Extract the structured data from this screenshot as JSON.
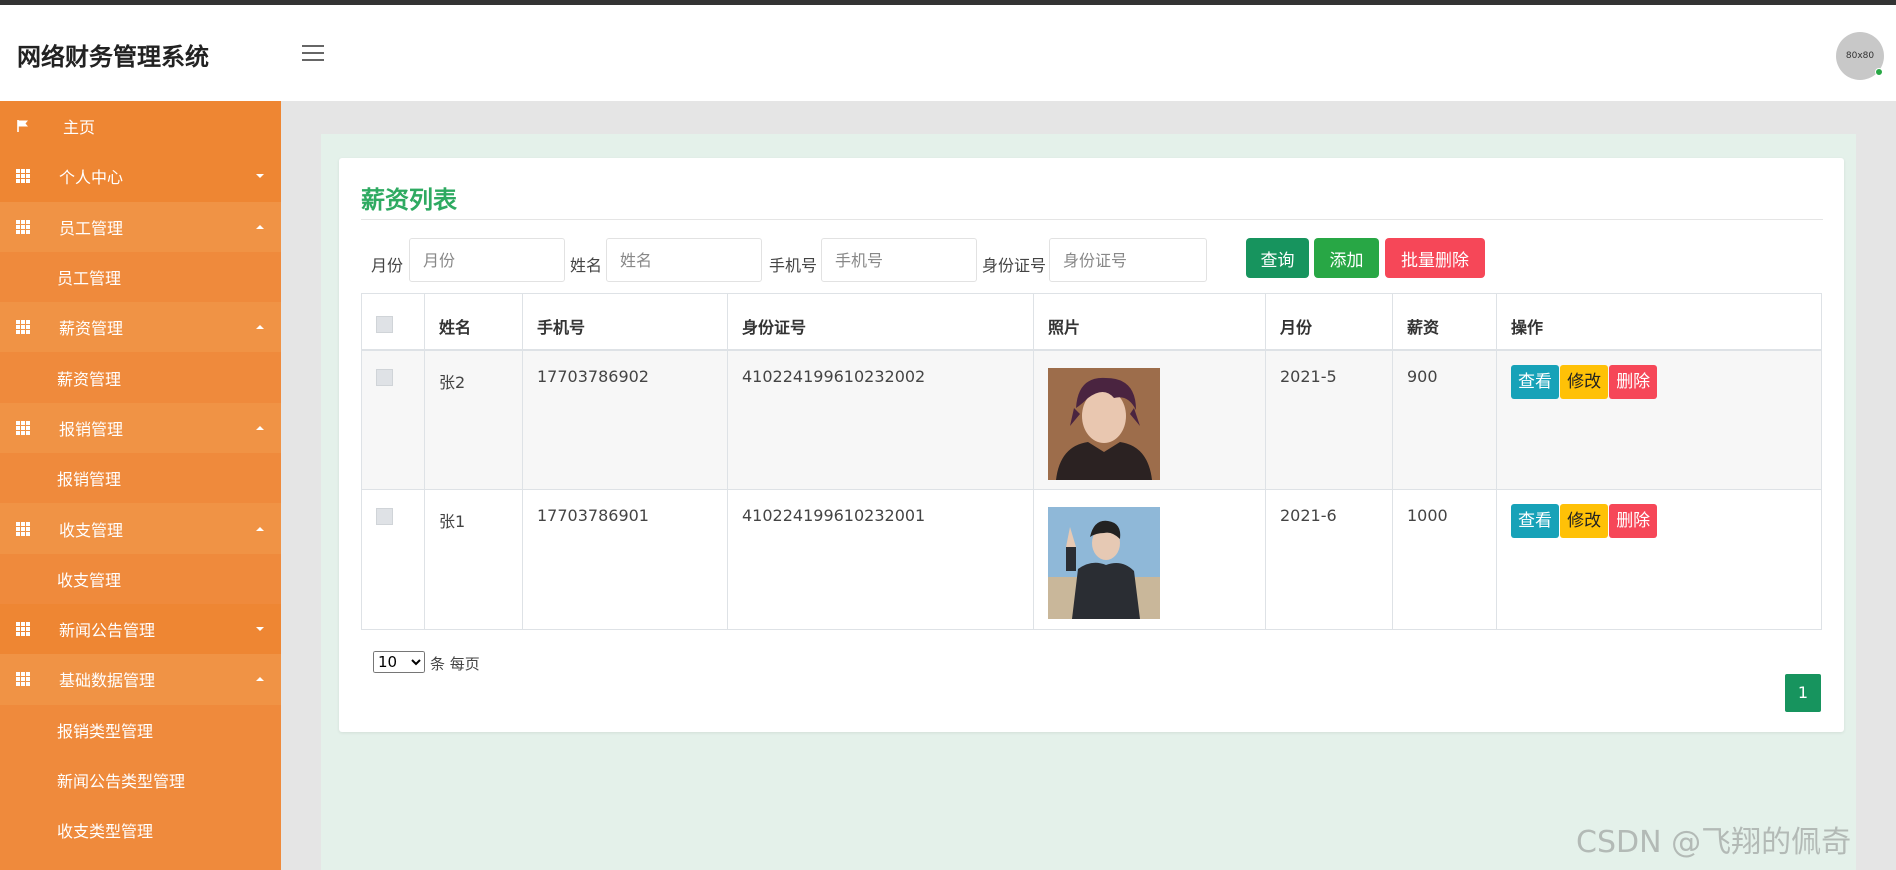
{
  "app": {
    "title": "网络财务管理系统",
    "avatar_text": "80x80"
  },
  "sidebar": {
    "items": [
      {
        "label": "主页",
        "type": "home"
      },
      {
        "label": "个人中心",
        "type": "parent",
        "expanded": false
      },
      {
        "label": "员工管理",
        "type": "parent",
        "expanded": true
      },
      {
        "label": "员工管理",
        "type": "child"
      },
      {
        "label": "薪资管理",
        "type": "parent",
        "expanded": true
      },
      {
        "label": "薪资管理",
        "type": "child"
      },
      {
        "label": "报销管理",
        "type": "parent",
        "expanded": true
      },
      {
        "label": "报销管理",
        "type": "child"
      },
      {
        "label": "收支管理",
        "type": "parent",
        "expanded": true
      },
      {
        "label": "收支管理",
        "type": "child"
      },
      {
        "label": "新闻公告管理",
        "type": "parent",
        "expanded": false
      },
      {
        "label": "基础数据管理",
        "type": "parent",
        "expanded": true
      },
      {
        "label": "报销类型管理",
        "type": "child"
      },
      {
        "label": "新闻公告类型管理",
        "type": "child"
      },
      {
        "label": "收支类型管理",
        "type": "child"
      }
    ]
  },
  "page": {
    "title": "薪资列表"
  },
  "search": {
    "month_label": "月份",
    "month_placeholder": "月份",
    "name_label": "姓名",
    "name_placeholder": "姓名",
    "phone_label": "手机号",
    "phone_placeholder": "手机号",
    "idcard_label": "身份证号",
    "idcard_placeholder": "身份证号",
    "query_button": "查询",
    "add_button": "添加",
    "batch_delete_button": "批量删除"
  },
  "table": {
    "headers": [
      "姓名",
      "手机号",
      "身份证号",
      "照片",
      "月份",
      "薪资",
      "操作"
    ],
    "rows": [
      {
        "name": "张2",
        "phone": "17703786902",
        "idcard": "410224199610232002",
        "photo": "portrait-dark-hoodie",
        "month": "2021-5",
        "salary": "900"
      },
      {
        "name": "张1",
        "phone": "17703786901",
        "idcard": "410224199610232001",
        "photo": "portrait-beach-jacket",
        "month": "2021-6",
        "salary": "1000"
      }
    ],
    "actions": {
      "view": "查看",
      "edit": "修改",
      "delete": "删除"
    }
  },
  "pagination": {
    "page_size": "10",
    "page_size_options": [
      "10"
    ],
    "per_page_text": "条 每页",
    "current_page": "1"
  },
  "watermark": "CSDN @飞翔的佩奇",
  "colors": {
    "sidebar": "#ef8a3c",
    "accent_green": "#2eaa61",
    "query_button": "#17945e",
    "add_button": "#28a745",
    "danger": "#f64758",
    "info": "#17a2b8",
    "warning": "#ffc107"
  }
}
